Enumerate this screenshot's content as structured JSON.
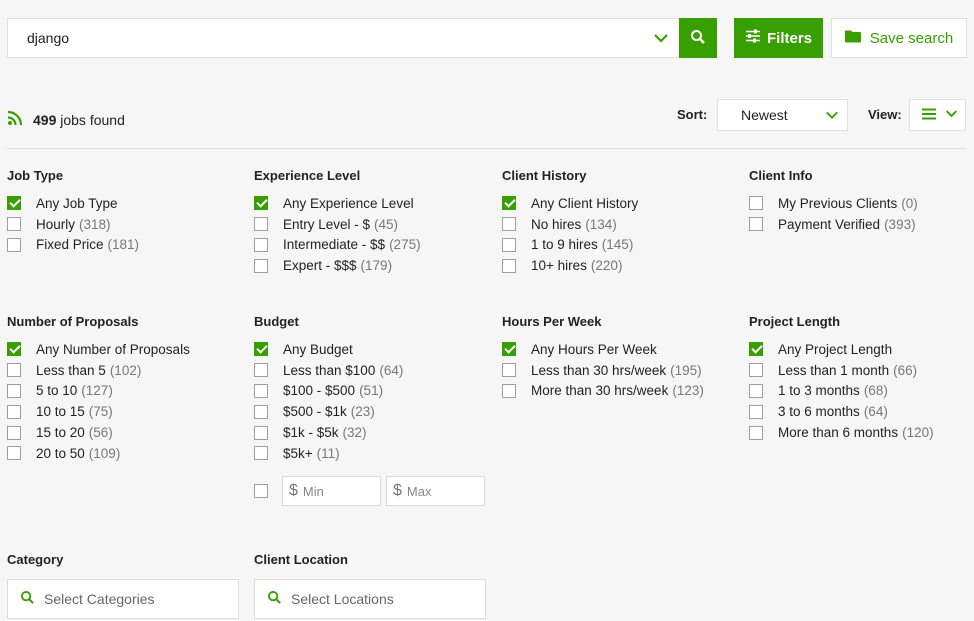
{
  "search": {
    "value": "django"
  },
  "buttons": {
    "filters": "Filters",
    "save_search": "Save search"
  },
  "results": {
    "count": "499",
    "label": "jobs found"
  },
  "sort": {
    "label": "Sort:",
    "value": "Newest"
  },
  "view": {
    "label": "View:"
  },
  "groups": [
    {
      "title": "Job Type",
      "options": [
        {
          "label": "Any Job Type",
          "count": "",
          "checked": true
        },
        {
          "label": "Hourly",
          "count": "(318)",
          "checked": false
        },
        {
          "label": "Fixed Price",
          "count": "(181)",
          "checked": false
        }
      ]
    },
    {
      "title": "Experience Level",
      "options": [
        {
          "label": "Any Experience Level",
          "count": "",
          "checked": true
        },
        {
          "label": "Entry Level - $",
          "count": "(45)",
          "checked": false
        },
        {
          "label": "Intermediate - $$",
          "count": "(275)",
          "checked": false
        },
        {
          "label": "Expert - $$$",
          "count": "(179)",
          "checked": false
        }
      ]
    },
    {
      "title": "Client History",
      "options": [
        {
          "label": "Any Client History",
          "count": "",
          "checked": true
        },
        {
          "label": "No hires",
          "count": "(134)",
          "checked": false
        },
        {
          "label": "1 to 9 hires",
          "count": "(145)",
          "checked": false
        },
        {
          "label": "10+ hires",
          "count": "(220)",
          "checked": false
        }
      ]
    },
    {
      "title": "Client Info",
      "options": [
        {
          "label": "My Previous Clients",
          "count": "(0)",
          "checked": false
        },
        {
          "label": "Payment Verified",
          "count": "(393)",
          "checked": false
        }
      ]
    },
    {
      "title": "Number of Proposals",
      "options": [
        {
          "label": "Any Number of Proposals",
          "count": "",
          "checked": true
        },
        {
          "label": "Less than 5",
          "count": "(102)",
          "checked": false
        },
        {
          "label": "5 to 10",
          "count": "(127)",
          "checked": false
        },
        {
          "label": "10 to 15",
          "count": "(75)",
          "checked": false
        },
        {
          "label": "15 to 20",
          "count": "(56)",
          "checked": false
        },
        {
          "label": "20 to 50",
          "count": "(109)",
          "checked": false
        }
      ]
    },
    {
      "title": "Budget",
      "options": [
        {
          "label": "Any Budget",
          "count": "",
          "checked": true
        },
        {
          "label": "Less than $100",
          "count": "(64)",
          "checked": false
        },
        {
          "label": "$100 - $500",
          "count": "(51)",
          "checked": false
        },
        {
          "label": "$500 - $1k",
          "count": "(23)",
          "checked": false
        },
        {
          "label": "$1k - $5k",
          "count": "(32)",
          "checked": false
        },
        {
          "label": "$5k+",
          "count": "(11)",
          "checked": false
        }
      ]
    },
    {
      "title": "Hours Per Week",
      "options": [
        {
          "label": "Any Hours Per Week",
          "count": "",
          "checked": true
        },
        {
          "label": "Less than 30 hrs/week",
          "count": "(195)",
          "checked": false
        },
        {
          "label": "More than 30 hrs/week",
          "count": "(123)",
          "checked": false
        }
      ]
    },
    {
      "title": "Project Length",
      "options": [
        {
          "label": "Any Project Length",
          "count": "",
          "checked": true
        },
        {
          "label": "Less than 1 month",
          "count": "(66)",
          "checked": false
        },
        {
          "label": "1 to 3 months",
          "count": "(68)",
          "checked": false
        },
        {
          "label": "3 to 6 months",
          "count": "(64)",
          "checked": false
        },
        {
          "label": "More than 6 months",
          "count": "(120)",
          "checked": false
        }
      ]
    }
  ],
  "budget_range": {
    "currency": "$",
    "min_placeholder": "Min",
    "max_placeholder": "Max"
  },
  "category": {
    "title": "Category",
    "placeholder": "Select Categories"
  },
  "client_location": {
    "title": "Client Location",
    "placeholder": "Select Locations"
  },
  "colors": {
    "accent": "#37a000",
    "background": "#f6f6f6"
  },
  "icons": {
    "search": "search-icon",
    "filters": "sliders-icon",
    "save": "folder-icon",
    "rss": "rss-icon",
    "list": "list-view-icon",
    "chevron": "chevron-down-icon"
  }
}
